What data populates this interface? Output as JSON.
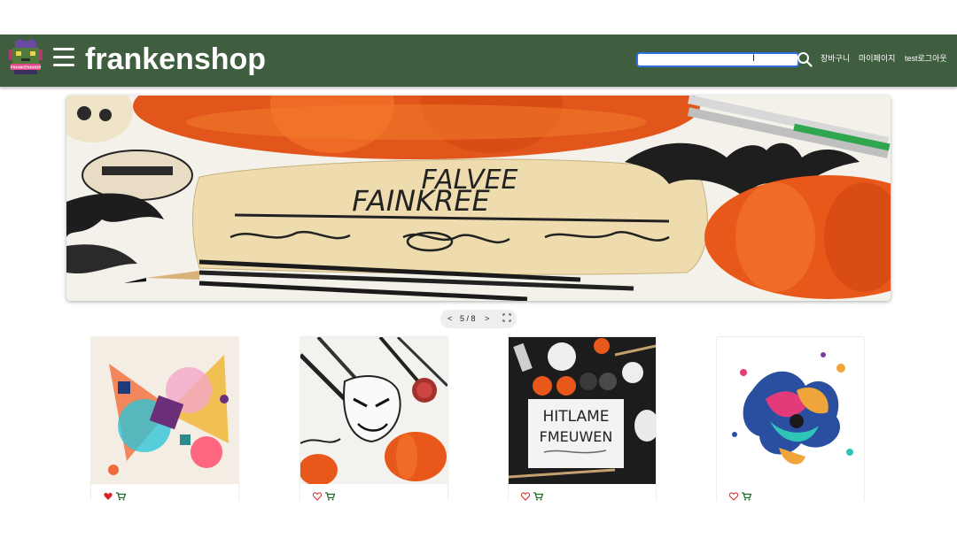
{
  "header": {
    "logo_text": "FRANKENSHOP",
    "brand": "frankenshop",
    "search": {
      "value": "",
      "placeholder": ""
    },
    "nav": {
      "cart": "장바구니",
      "mypage": "마이페이지",
      "logout": "test로그아웃"
    },
    "bg_color": "#3e5e3f"
  },
  "hero": {
    "sign_text_line1": "FALVEE",
    "sign_text_line2": "FAINKREE"
  },
  "carousel": {
    "prev": "<",
    "next": ">",
    "counter": "5 / 8"
  },
  "products": [
    {
      "image": "abstract-paint-splash",
      "liked": true
    },
    {
      "image": "monster-sketch-pumpkins",
      "liked": false
    },
    {
      "image": "halloween-sign-pumpkins",
      "liked": false,
      "sign_line1": "HITLAME",
      "sign_line2": "FMEUWEN"
    },
    {
      "image": "ink-splash-colorful",
      "liked": false
    }
  ],
  "colors": {
    "heart": "#d62828",
    "cart": "#1f6b2a",
    "search_border": "#2f6fe0"
  }
}
